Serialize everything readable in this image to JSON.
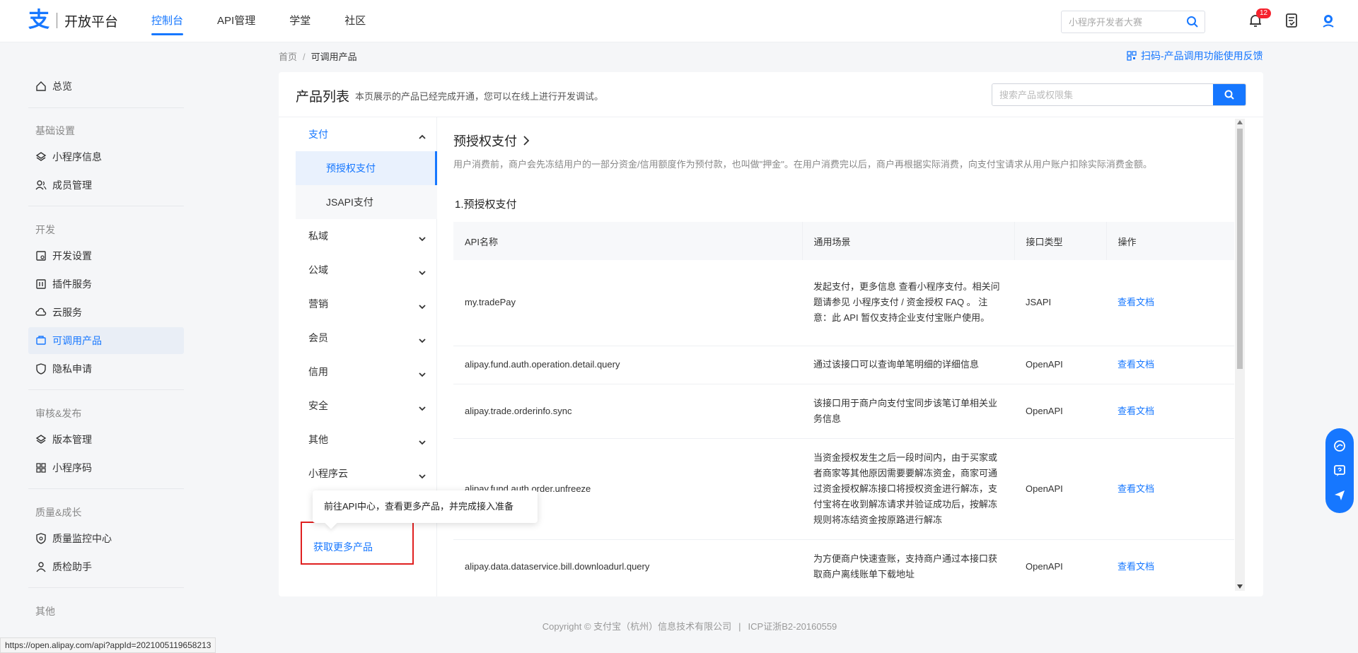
{
  "header": {
    "logo_glyph": "支",
    "logo_text": "开放平台",
    "nav": [
      "控制台",
      "API管理",
      "学堂",
      "社区"
    ],
    "search_placeholder": "小程序开发者大赛",
    "notification_count": "12",
    "accent_color": "#1677ff"
  },
  "sidebar": {
    "items": {
      "overview": "总览",
      "group_basic": "基础设置",
      "miniapp_info": "小程序信息",
      "members": "成员管理",
      "group_dev": "开发",
      "dev_settings": "开发设置",
      "plugins": "插件服务",
      "cloud": "云服务",
      "products": "可调用产品",
      "privacy": "隐私申请",
      "group_review": "审核&发布",
      "versions": "版本管理",
      "qrcode": "小程序码",
      "group_quality": "质量&成长",
      "quality_center": "质量监控中心",
      "quality_helper": "质检助手",
      "group_other": "其他"
    }
  },
  "breadcrumb": {
    "home": "首页",
    "sep": "/",
    "current": "可调用产品"
  },
  "feedback_link": "扫码-产品调用功能使用反馈",
  "card": {
    "title": "产品列表",
    "desc": "本页展示的产品已经完成开通，您可以在线上进行开发调试。",
    "search_placeholder": "搜索产品或权限集"
  },
  "categories": {
    "pay": "支付",
    "pay_sub1": "预授权支付",
    "pay_sub2": "JSAPI支付",
    "private": "私域",
    "public": "公域",
    "marketing": "营销",
    "member": "会员",
    "credit": "信用",
    "security": "安全",
    "other": "其他",
    "cloud": "小程序云"
  },
  "tooltip": "前往API中心，查看更多产品，并完成接入准备",
  "more_products": "获取更多产品",
  "product": {
    "title": "预授权支付",
    "desc": "用户消费前，商户会先冻结用户的一部分资金/信用额度作为预付款，也叫做\"押金\"。在用户消费完以后，商户再根据实际消费，向支付宝请求从用户账户扣除实际消费金额。",
    "section": "1.预授权支付"
  },
  "table": {
    "headers": {
      "name": "API名称",
      "scene": "通用场景",
      "type": "接口类型",
      "op": "操作"
    },
    "rows": [
      {
        "name": "my.tradePay",
        "scene": "发起支付，更多信息 查看小程序支付。相关问题请参见 小程序支付 / 资金授权 FAQ 。 注意：此 API 暂仅支持企业支付宝账户使用。",
        "type": "JSAPI",
        "op": "查看文档"
      },
      {
        "name": "alipay.fund.auth.operation.detail.query",
        "scene": "通过该接口可以查询单笔明细的详细信息",
        "type": "OpenAPI",
        "op": "查看文档"
      },
      {
        "name": "alipay.trade.orderinfo.sync",
        "scene": "该接口用于商户向支付宝同步该笔订单相关业务信息",
        "type": "OpenAPI",
        "op": "查看文档"
      },
      {
        "name": "alipay.fund.auth.order.unfreeze",
        "scene": "当资金授权发生之后一段时间内，由于买家或者商家等其他原因需要要解冻资金，商家可通过资金授权解冻接口将授权资金进行解冻，支付宝将在收到解冻请求并验证成功后，按解冻规则将冻结资金按原路进行解冻",
        "type": "OpenAPI",
        "op": "查看文档"
      },
      {
        "name": "alipay.data.dataservice.bill.downloadurl.query",
        "scene": "为方便商户快速查账，支持商户通过本接口获取商户离线账单下载地址",
        "type": "OpenAPI",
        "op": "查看文档"
      }
    ]
  },
  "footer": {
    "copyright": "Copyright © 支付宝（杭州）信息技术有限公司",
    "sep": "|",
    "icp": "ICP证浙B2-20160559"
  },
  "status_url": "https://open.alipay.com/api?appId=2021005119658213"
}
